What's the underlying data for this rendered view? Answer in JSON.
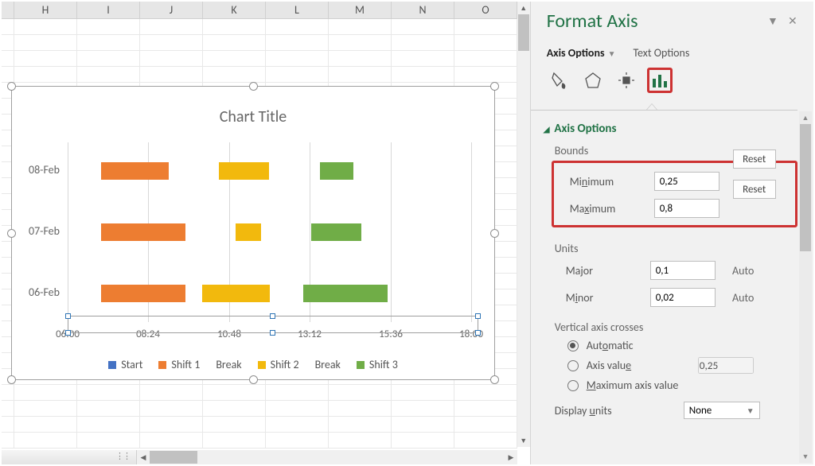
{
  "columns": [
    "H",
    "I",
    "J",
    "K",
    "L",
    "M",
    "N",
    "O"
  ],
  "chart": {
    "title": "Chart Title",
    "ylabels": [
      "08-Feb",
      "07-Feb",
      "06-Feb"
    ],
    "xticks": [
      "06:00",
      "08:24",
      "10:48",
      "13:12",
      "15:36",
      "18:00"
    ],
    "legend": [
      {
        "label": "Start",
        "color": "#4472c4"
      },
      {
        "label": "Shift 1",
        "color": "#ed7d31"
      },
      {
        "label": "Break",
        "color": ""
      },
      {
        "label": "Shift 2",
        "color": "#f2b90d"
      },
      {
        "label": "Break",
        "color": ""
      },
      {
        "label": "Shift 3",
        "color": "#70ad47"
      }
    ]
  },
  "chart_data": {
    "type": "bar",
    "orientation": "horizontal-stacked-gantt",
    "title": "Chart Title",
    "xlabel": "",
    "ylabel": "",
    "x_unit": "time-of-day",
    "xlim": [
      "06:00",
      "19:12"
    ],
    "categories": [
      "08-Feb",
      "07-Feb",
      "06-Feb"
    ],
    "series": [
      {
        "name": "Start",
        "color": "#4472c4",
        "visible": false,
        "values": [
          "07:00",
          "07:00",
          "07:00"
        ]
      },
      {
        "name": "Shift 1",
        "color": "#ed7d31",
        "values": [
          "02:00",
          "02:30",
          "02:30"
        ]
      },
      {
        "name": "Break",
        "color": "",
        "values": [
          "01:30",
          "01:30",
          "00:30"
        ]
      },
      {
        "name": "Shift 2",
        "color": "#f2b90d",
        "values": [
          "01:30",
          "00:45",
          "02:00"
        ]
      },
      {
        "name": "Break",
        "color": "",
        "values": [
          "01:30",
          "01:30",
          "01:00"
        ]
      },
      {
        "name": "Shift 3",
        "color": "#70ad47",
        "values": [
          "01:00",
          "01:30",
          "02:30"
        ]
      }
    ]
  },
  "panel": {
    "title": "Format Axis",
    "tabs": {
      "axis": "Axis Options",
      "text": "Text Options"
    },
    "section": "Axis Options",
    "bounds_label": "Bounds",
    "min_label_pre": "Mi",
    "min_label_u": "n",
    "min_label_post": "imum",
    "max_label_pre": "Ma",
    "max_label_u": "x",
    "max_label_post": "imum",
    "min_value": "0,25",
    "max_value": "0,8",
    "reset": "Reset",
    "units_label": "Units",
    "major_label_pre": "Ma",
    "major_label_u": "j",
    "major_label_post": "or",
    "minor_label_pre": "M",
    "minor_label_u": "i",
    "minor_label_post": "nor",
    "major_value": "0,1",
    "minor_value": "0,02",
    "auto": "Auto",
    "vac": "Vertical axis crosses",
    "r_auto_pre": "Aut",
    "r_auto_u": "o",
    "r_auto_post": "matic",
    "r_val_pre": "Axis valu",
    "r_val_u": "e",
    "r_val_post": "",
    "r_val_value": "0,25",
    "r_max_pre": "",
    "r_max_u": "M",
    "r_max_post": "aximum axis value",
    "du_label_pre": "Display ",
    "du_label_u": "u",
    "du_label_post": "nits",
    "du_value": "None"
  }
}
